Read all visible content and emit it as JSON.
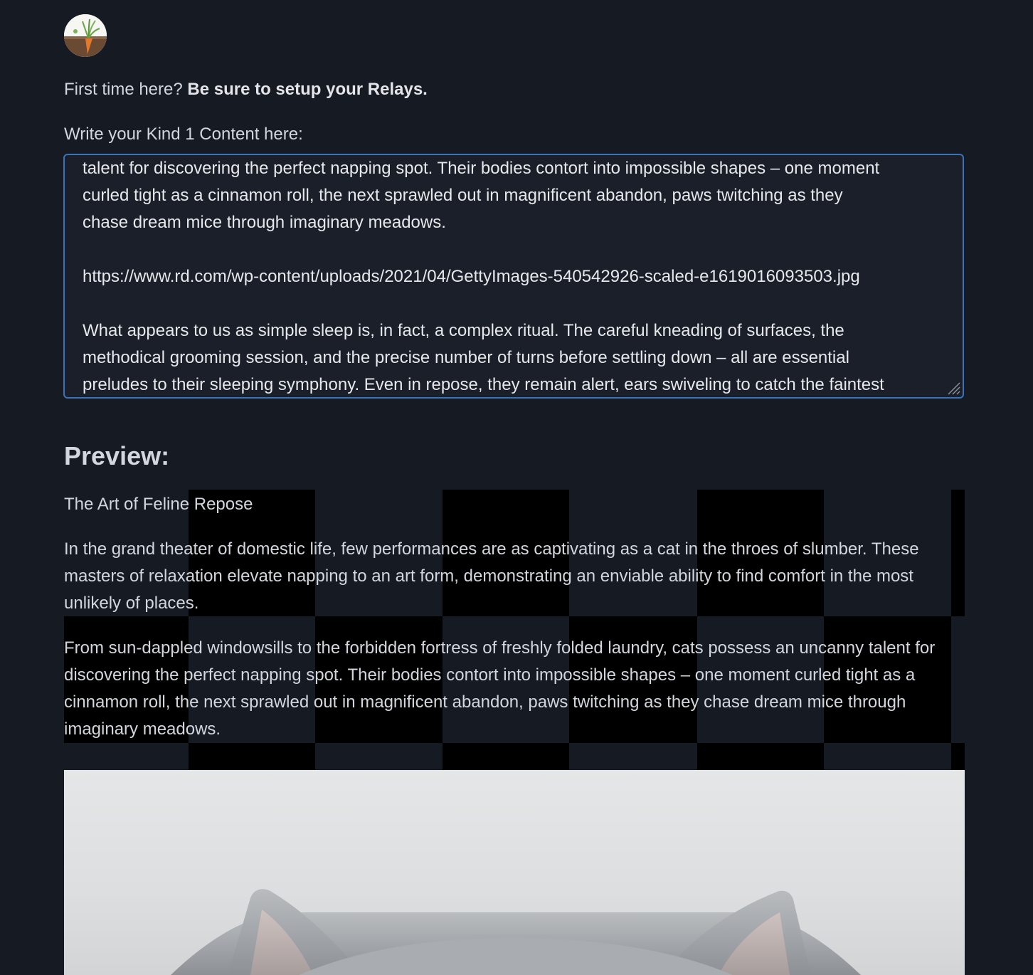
{
  "intro": {
    "question": "First time here?",
    "cta": "Be sure to setup your Relays."
  },
  "editor": {
    "label": "Write your Kind 1 Content here:",
    "visible_lines": [
      "talent for discovering the perfect napping spot. Their bodies contort into impossible shapes – one moment",
      "curled tight as a cinnamon roll, the next sprawled out in magnificent abandon, paws twitching as they",
      "chase dream mice through imaginary meadows.",
      "",
      "https://www.rd.com/wp-content/uploads/2021/04/GettyImages-540542926-scaled-e1619016093503.jpg",
      "",
      "What appears to us as simple sleep is, in fact, a complex ritual. The careful kneading of surfaces, the",
      "methodical grooming session, and the precise number of turns before settling down – all are essential",
      "preludes to their sleeping symphony. Even in repose, they remain alert, ears swiveling to catch the faintest"
    ]
  },
  "preview": {
    "heading": "Preview:",
    "title": "The Art of Feline Repose",
    "paragraph_1": "In the grand theater of domestic life, few performances are as captivating as a cat in the throes of slumber. These masters of relaxation elevate napping to an art form, demonstrating an enviable ability to find comfort in the most unlikely of places.",
    "paragraph_2": "From sun-dappled windowsills to the forbidden fortress of freshly folded laundry, cats possess an uncanny talent for discovering the perfect napping spot. Their bodies contort into impossible shapes – one moment curled tight as a cinnamon roll, the next sprawled out in magnificent abandon, paws twitching as they chase dream mice through imaginary meadows."
  },
  "colors": {
    "background": "#161a23",
    "editor_border": "#3b73b8",
    "text": "#d3d6dc"
  }
}
